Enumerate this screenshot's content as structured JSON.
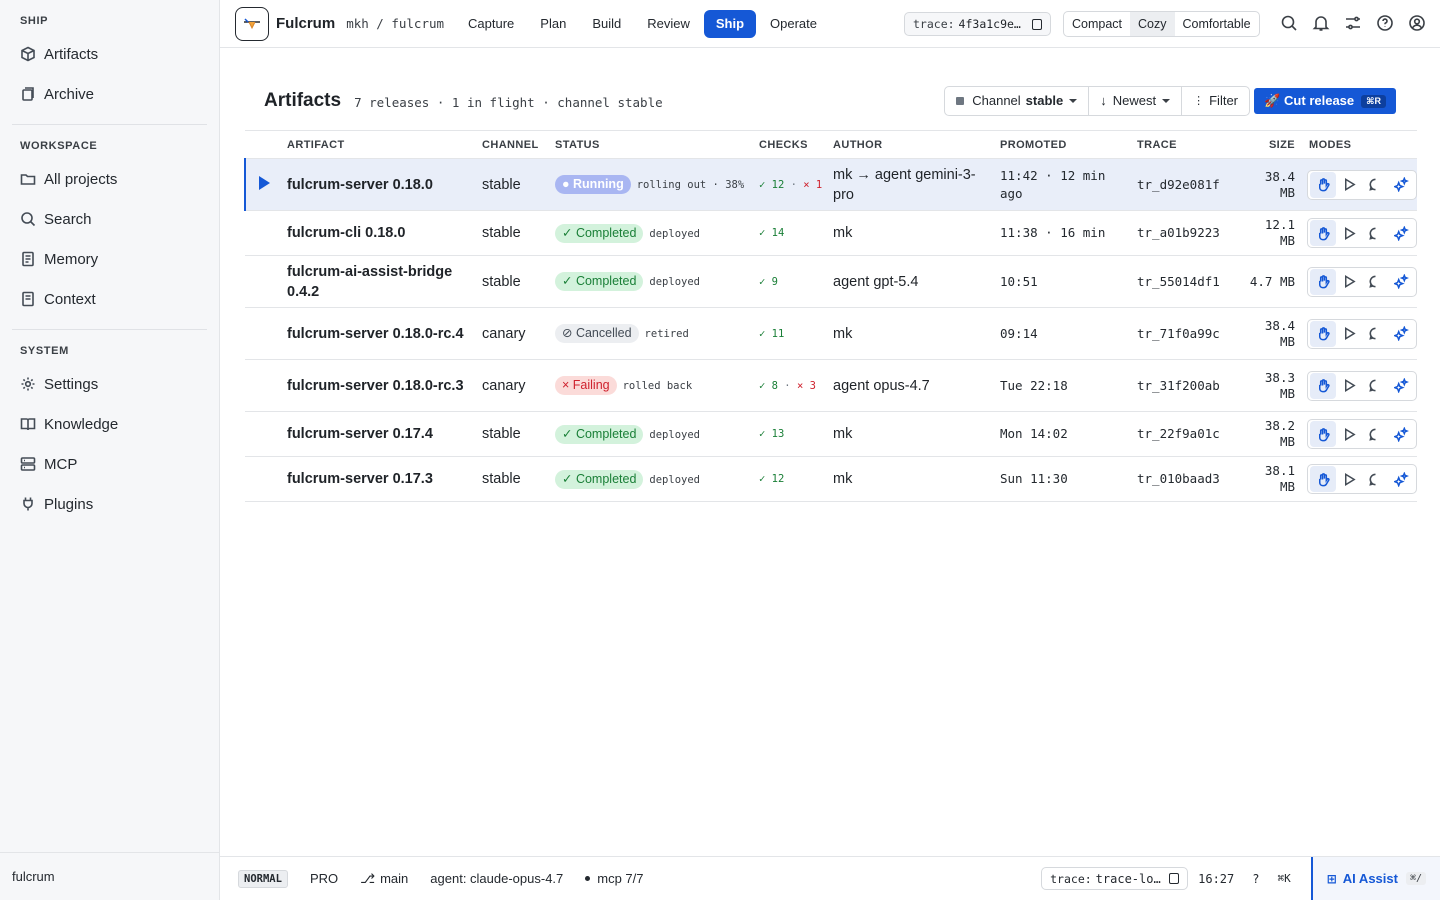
{
  "sidebar": {
    "sections": [
      {
        "heading": "SHIP",
        "items": [
          {
            "label": "Artifacts",
            "icon": "cube-icon"
          },
          {
            "label": "Archive",
            "icon": "archive-icon"
          }
        ]
      },
      {
        "heading": "WORKSPACE",
        "items": [
          {
            "label": "All projects",
            "icon": "folder-icon"
          },
          {
            "label": "Search",
            "icon": "search-icon"
          },
          {
            "label": "Memory",
            "icon": "memory-icon"
          },
          {
            "label": "Context",
            "icon": "context-icon"
          }
        ]
      },
      {
        "heading": "SYSTEM",
        "items": [
          {
            "label": "Settings",
            "icon": "gear-icon"
          },
          {
            "label": "Knowledge",
            "icon": "book-icon"
          },
          {
            "label": "MCP",
            "icon": "server-icon"
          },
          {
            "label": "Plugins",
            "icon": "plug-icon"
          }
        ]
      }
    ],
    "footer": "fulcrum"
  },
  "topbar": {
    "brand": "Fulcrum",
    "breadcrumb": "mkh / fulcrum",
    "tabs": [
      "Capture",
      "Plan",
      "Build",
      "Review",
      "Ship",
      "Operate"
    ],
    "active_tab": "Ship",
    "trace_label": "trace:",
    "trace_value": "4f3a1c9e…",
    "density": [
      "Compact",
      "Cozy",
      "Comfortable"
    ],
    "density_selected": "Cozy"
  },
  "panel": {
    "title": "Artifacts",
    "meta": "7 releases · 1 in flight · channel stable",
    "channel_label": "Channel",
    "channel_value": "stable",
    "sort_label": "Newest",
    "filter_label": "Filter",
    "cut_label": "🚀 Cut release",
    "cut_kbd": "⌘R"
  },
  "table": {
    "headers": [
      "ARTIFACT",
      "CHANNEL",
      "STATUS",
      "CHECKS",
      "AUTHOR",
      "PROMOTED",
      "TRACE",
      "SIZE",
      "MODES"
    ],
    "rows": [
      {
        "artifact": "fulcrum-server 0.18.0",
        "channel": "stable",
        "status": "● Running",
        "status_kind": "running",
        "note": "rolling out · 38%",
        "checks_ok": "✓ 12",
        "checks_bad": "× 1",
        "author": "mk → agent gemini-3-pro",
        "promoted": "11:42 · 12 min ago",
        "trace": "tr_d92e081f",
        "size": "38.4 MB",
        "selected": true
      },
      {
        "artifact": "fulcrum-cli 0.18.0",
        "channel": "stable",
        "status": "✓ Completed",
        "status_kind": "completed",
        "note": "deployed",
        "checks_ok": "✓ 14",
        "checks_bad": "",
        "author": "mk",
        "promoted": "11:38 · 16 min",
        "trace": "tr_a01b9223",
        "size": "12.1 MB",
        "selected": false
      },
      {
        "artifact": "fulcrum-ai-assist-bridge 0.4.2",
        "channel": "stable",
        "status": "✓ Completed",
        "status_kind": "completed",
        "note": "deployed",
        "checks_ok": "✓ 9",
        "checks_bad": "",
        "author": "agent gpt-5.4",
        "promoted": "10:51",
        "trace": "tr_55014df1",
        "size": "4.7 MB",
        "selected": false
      },
      {
        "artifact": "fulcrum-server 0.18.0-rc.4",
        "channel": "canary",
        "status": "⊘ Cancelled",
        "status_kind": "cancelled",
        "note": "retired",
        "checks_ok": "✓ 11",
        "checks_bad": "",
        "author": "mk",
        "promoted": "09:14",
        "trace": "tr_71f0a99c",
        "size": "38.4 MB",
        "selected": false
      },
      {
        "artifact": "fulcrum-server 0.18.0-rc.3",
        "channel": "canary",
        "status": "× Failing",
        "status_kind": "failing",
        "note": "rolled back",
        "checks_ok": "✓ 8",
        "checks_bad": "× 3",
        "author": "agent opus-4.7",
        "promoted": "Tue 22:18",
        "trace": "tr_31f200ab",
        "size": "38.3 MB",
        "selected": false
      },
      {
        "artifact": "fulcrum-server 0.17.4",
        "channel": "stable",
        "status": "✓ Completed",
        "status_kind": "completed",
        "note": "deployed",
        "checks_ok": "✓ 13",
        "checks_bad": "",
        "author": "mk",
        "promoted": "Mon 14:02",
        "trace": "tr_22f9a01c",
        "size": "38.2 MB",
        "selected": false
      },
      {
        "artifact": "fulcrum-server 0.17.3",
        "channel": "stable",
        "status": "✓ Completed",
        "status_kind": "completed",
        "note": "deployed",
        "checks_ok": "✓ 12",
        "checks_bad": "",
        "author": "mk",
        "promoted": "Sun 11:30",
        "trace": "tr_010baad3",
        "size": "38.1 MB",
        "selected": false
      }
    ],
    "mode_icons": [
      "hand-icon",
      "play-icon",
      "chat-icon",
      "sparkle-icon"
    ]
  },
  "statusbar": {
    "mode": "NORMAL",
    "plan": "PRO",
    "branch": "main",
    "agent": "agent: claude-opus-4.7",
    "mcp": "mcp 7/7",
    "trace_label": "trace:",
    "trace_value": "trace-lo…",
    "time": "16:27",
    "help": "?",
    "kbd": "⌘K",
    "assist_label": "AI Assist",
    "assist_kbd": "⌘/"
  },
  "colors": {
    "accent": "#1558d6",
    "success": "#1a7f37",
    "danger": "#cf222e"
  }
}
